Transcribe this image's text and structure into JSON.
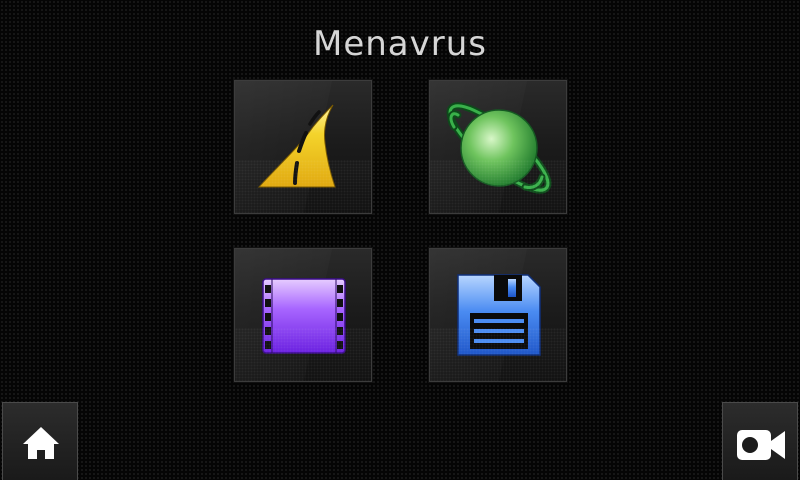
{
  "header": {
    "title": "Menavrus"
  },
  "tiles": [
    {
      "id": "navigation",
      "icon": "road-icon"
    },
    {
      "id": "internet",
      "icon": "planet-icon"
    },
    {
      "id": "video",
      "icon": "film-strip-icon"
    },
    {
      "id": "storage",
      "icon": "floppy-disk-icon"
    }
  ],
  "footer": {
    "left_icon": "home-icon",
    "right_icon": "video-camera-icon"
  },
  "colors": {
    "road": "#f2cf2a",
    "planet": "#3fae4a",
    "film": "#8a3ff0",
    "floppy": "#3a78e8"
  }
}
